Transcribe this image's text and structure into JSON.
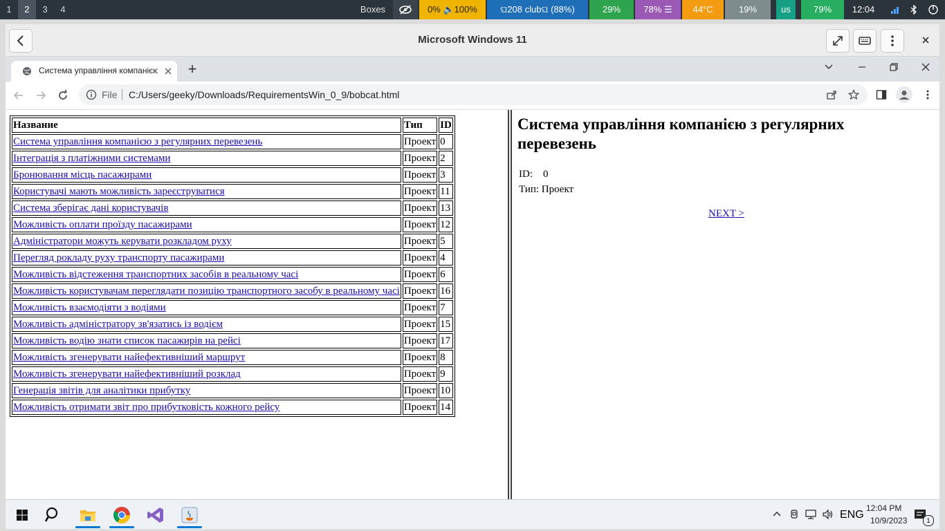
{
  "statusbar": {
    "workspaces": [
      "1",
      "2",
      "3",
      "4"
    ],
    "active_workspace": "2",
    "window_label": "Boxes",
    "volume": "0% 🔈100%",
    "wifi": "ଘ208 clubଘ (88%)",
    "cpu": "29%",
    "mem": "78% ☰",
    "temp": "44°C",
    "disk": "19%",
    "layout": "us",
    "battery": "79%",
    "time": "12:04",
    "colors": {
      "volume": "#f0b400",
      "wifi": "#1e6fb8",
      "cpu": "#2ea44f",
      "mem": "#9b59b6",
      "temp": "#f39c12",
      "disk": "#7f8c8d",
      "layout": "#16a085",
      "battery": "#27ae60"
    }
  },
  "vm": {
    "title": "Microsoft Windows 11"
  },
  "browser": {
    "tab_title": "Система управління компанією",
    "new_tab": "+",
    "url_scheme_label": "File",
    "url": "C:/Users/geeky/Downloads/RequirementsWin_0_9/bobcat.html"
  },
  "table": {
    "headers": [
      "Название",
      "Тип",
      "ID"
    ],
    "rows": [
      {
        "name": "Система управління компанією з регулярних перевезень",
        "type": "Проект",
        "id": "0"
      },
      {
        "name": "Інтеграція з платіжними системами",
        "type": "Проект",
        "id": "2"
      },
      {
        "name": "Бронювання місць пасажирами",
        "type": "Проект",
        "id": "3"
      },
      {
        "name": "Користувачі мають можливість зареєструватися",
        "type": "Проект",
        "id": "11"
      },
      {
        "name": "Система зберігає дані користувачів",
        "type": "Проект",
        "id": "13"
      },
      {
        "name": "Можливість оплати проїзду пасажирами",
        "type": "Проект",
        "id": "12"
      },
      {
        "name": "Адміністратори можуть керувати розкладом руху",
        "type": "Проект",
        "id": "5"
      },
      {
        "name": "Перегляд рокладу руху транспорту пасажирами",
        "type": "Проект",
        "id": "4"
      },
      {
        "name": "Можливість відстеження транспортних засобів в реальному часі",
        "type": "Проект",
        "id": "6"
      },
      {
        "name": "Можливість користувачам переглядати позицію транспортного засобу в реальному часі",
        "type": "Проект",
        "id": "16"
      },
      {
        "name": "Можливість взаємодіяти з водіями",
        "type": "Проект",
        "id": "7"
      },
      {
        "name": "Можливість адміністратору зв'язатись із водієм",
        "type": "Проект",
        "id": "15"
      },
      {
        "name": "Можливість водію знати список пасажирів на рейсі",
        "type": "Проект",
        "id": "17"
      },
      {
        "name": "Можливість згенерувати найефективніший маршрут",
        "type": "Проект",
        "id": "8"
      },
      {
        "name": "Можливість згенерувати найефективніший розклад",
        "type": "Проект",
        "id": "9"
      },
      {
        "name": "Генерація звітів для аналітики прибутку",
        "type": "Проект",
        "id": "10"
      },
      {
        "name": "Можливість отримати звіт про прибутковість кожного рейсу",
        "type": "Проект",
        "id": "14"
      }
    ]
  },
  "detail": {
    "title": "Система управління компанією з регулярних перевезень",
    "id_label": "ID:",
    "id_value": "0",
    "type_label": "Тип:",
    "type_value": "Проект",
    "next_link": "NEXT >"
  },
  "taskbar": {
    "language": "ENG",
    "time": "12:04 PM",
    "date": "10/9/2023",
    "notification_count": "1"
  }
}
